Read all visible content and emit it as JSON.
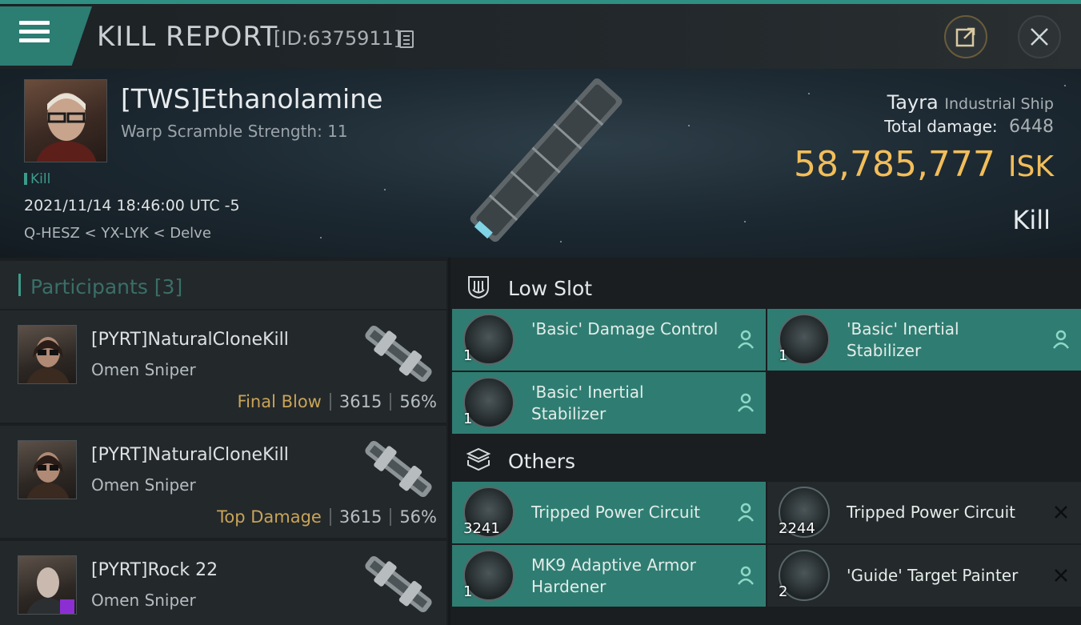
{
  "header": {
    "title": "KILL REPORT",
    "report_id": "[ID:6375911]"
  },
  "victim": {
    "name": "[TWS]Ethanolamine",
    "warp_scramble": "Warp Scramble Strength: 11",
    "kill_tag": "Kill",
    "timestamp": "2021/11/14 18:46:00 UTC -5",
    "location": "Q-HESZ < YX-LYK < Delve"
  },
  "ship": {
    "name": "Tayra",
    "class": "Industrial Ship",
    "total_damage_label": "Total damage:",
    "total_damage": "6448",
    "isk_value": "58,785,777",
    "isk_unit": "ISK",
    "result": "Kill"
  },
  "participants": {
    "title": "Participants [3]",
    "rows": [
      {
        "name": "[PYRT]NaturalCloneKill",
        "ship": "Omen Sniper",
        "tag": "Final Blow",
        "damage": "3615",
        "percent": "56%"
      },
      {
        "name": "[PYRT]NaturalCloneKill",
        "ship": "Omen Sniper",
        "tag": "Top Damage",
        "damage": "3615",
        "percent": "56%"
      },
      {
        "name": "[PYRT]Rock 22",
        "ship": "Omen Sniper",
        "tag": "",
        "damage": "",
        "percent": ""
      }
    ]
  },
  "fitting": {
    "low_slot": {
      "title": "Low Slot",
      "items": [
        {
          "name": "'Basic' Damage Control",
          "qty": "1",
          "status": "dropped"
        },
        {
          "name": "'Basic' Inertial Stabilizer",
          "qty": "1",
          "status": "dropped"
        },
        {
          "name": "'Basic' Inertial Stabilizer",
          "qty": "1",
          "status": "dropped"
        }
      ]
    },
    "others": {
      "title": "Others",
      "items": [
        {
          "name": "Tripped Power Circuit",
          "qty": "3241",
          "status": "dropped"
        },
        {
          "name": "Tripped Power Circuit",
          "qty": "2244",
          "status": "destroyed"
        },
        {
          "name": "MK9 Adaptive Armor Hardener",
          "qty": "1",
          "status": "dropped"
        },
        {
          "name": "'Guide' Target Painter",
          "qty": "2",
          "status": "destroyed"
        }
      ]
    }
  },
  "colors": {
    "accent_teal": "#2f7d72",
    "isk_gold": "#f2be5a",
    "tag_gold": "#c9a457"
  },
  "icons": [
    "menu-icon",
    "copy-icon",
    "share-icon",
    "close-icon",
    "low-slot-icon",
    "cube-icon",
    "person-icon",
    "x-icon"
  ]
}
